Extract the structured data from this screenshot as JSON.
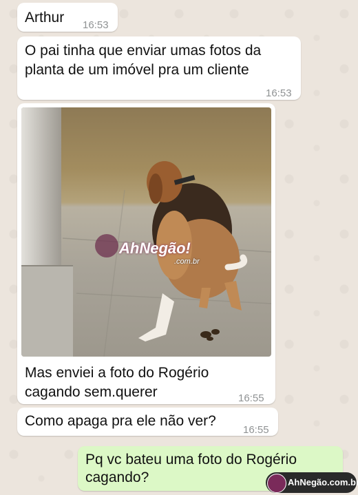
{
  "messages": [
    {
      "sender": "Arthur",
      "time": "16:53"
    },
    {
      "text_line1": "O pai tinha que enviar umas fotos da",
      "text_line2": "planta de um imóvel pra um cliente",
      "time": "16:53"
    },
    {
      "caption_line1": "Mas enviei a foto do Rogério",
      "caption_line2": "cagando sem.querer",
      "time": "16:55"
    },
    {
      "text": "Como apaga pra ele não ver?",
      "time": "16:55"
    },
    {
      "text_line1": "Pq vc bateu uma foto do Rogério",
      "text_line2": "cagando?"
    }
  ],
  "watermark": {
    "main": "AhNegão!",
    "sub": ".com.br"
  },
  "footer_logo": "AhNegão.com.br",
  "colors": {
    "incoming_bubble": "#ffffff",
    "outgoing_bubble": "#dcf8c6",
    "chat_background": "#ece5dd",
    "timestamp": "#8f9293"
  }
}
